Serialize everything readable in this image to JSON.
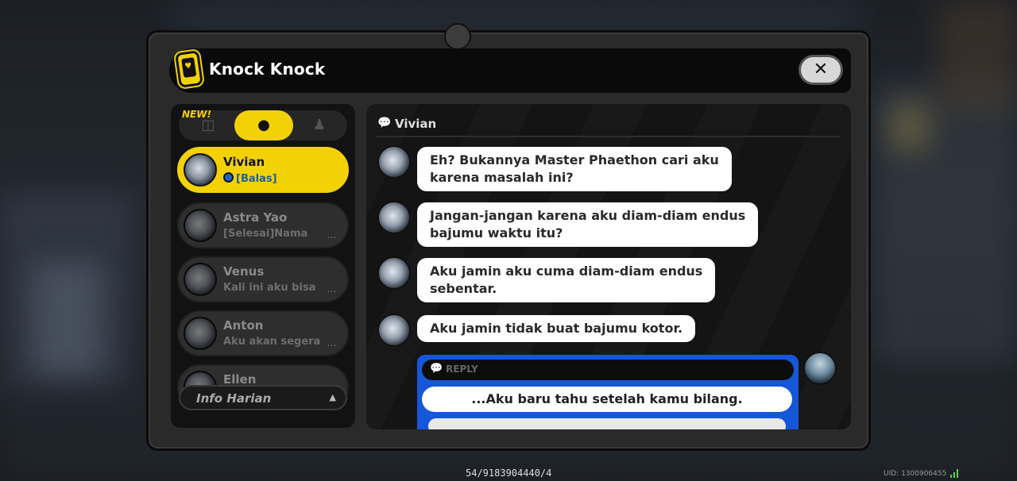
{
  "window": {
    "title": "Knock Knock",
    "close_icon": "x-icon"
  },
  "sidebar": {
    "new_badge": "NEW!",
    "tabs": [
      {
        "icon": "tab-icon-1",
        "glyph": "◫"
      },
      {
        "icon": "person-icon",
        "glyph": "●"
      },
      {
        "icon": "group-icon",
        "glyph": "♟"
      }
    ],
    "contacts": [
      {
        "name": "Vivian",
        "preview": "[Balas]",
        "active": true
      },
      {
        "name": "Astra Yao",
        "preview": "[Selesai]Nama",
        "active": false
      },
      {
        "name": "Venus",
        "preview": "Kali ini aku bisa",
        "active": false
      },
      {
        "name": "Anton",
        "preview": "Aku akan segera",
        "active": false
      },
      {
        "name": "Ellen",
        "preview": "",
        "active": false
      }
    ],
    "ellipsis": "...",
    "daily_label": "Info Harian"
  },
  "chat": {
    "contact_name": "Vivian",
    "messages": [
      {
        "line1": "Eh? Bukannya Master Phaethon cari aku",
        "line2": "karena masalah ini?"
      },
      {
        "line1": "Jangan-jangan karena aku diam-diam endus",
        "line2": "bajumu waktu itu?"
      },
      {
        "line1": "Aku jamin aku cuma diam-diam endus",
        "line2": "sebentar."
      },
      {
        "line1": "Aku jamin tidak buat bajumu kotor.",
        "line2": ""
      }
    ],
    "reply_label": "REPLY",
    "reply_option": "...Aku baru tahu setelah kamu bilang."
  },
  "footer": {
    "code": "54/9183904440/4",
    "uid": "UID: 1300906455"
  },
  "colors": {
    "accent_yellow": "#f2d205",
    "reply_blue": "#1557d8"
  }
}
